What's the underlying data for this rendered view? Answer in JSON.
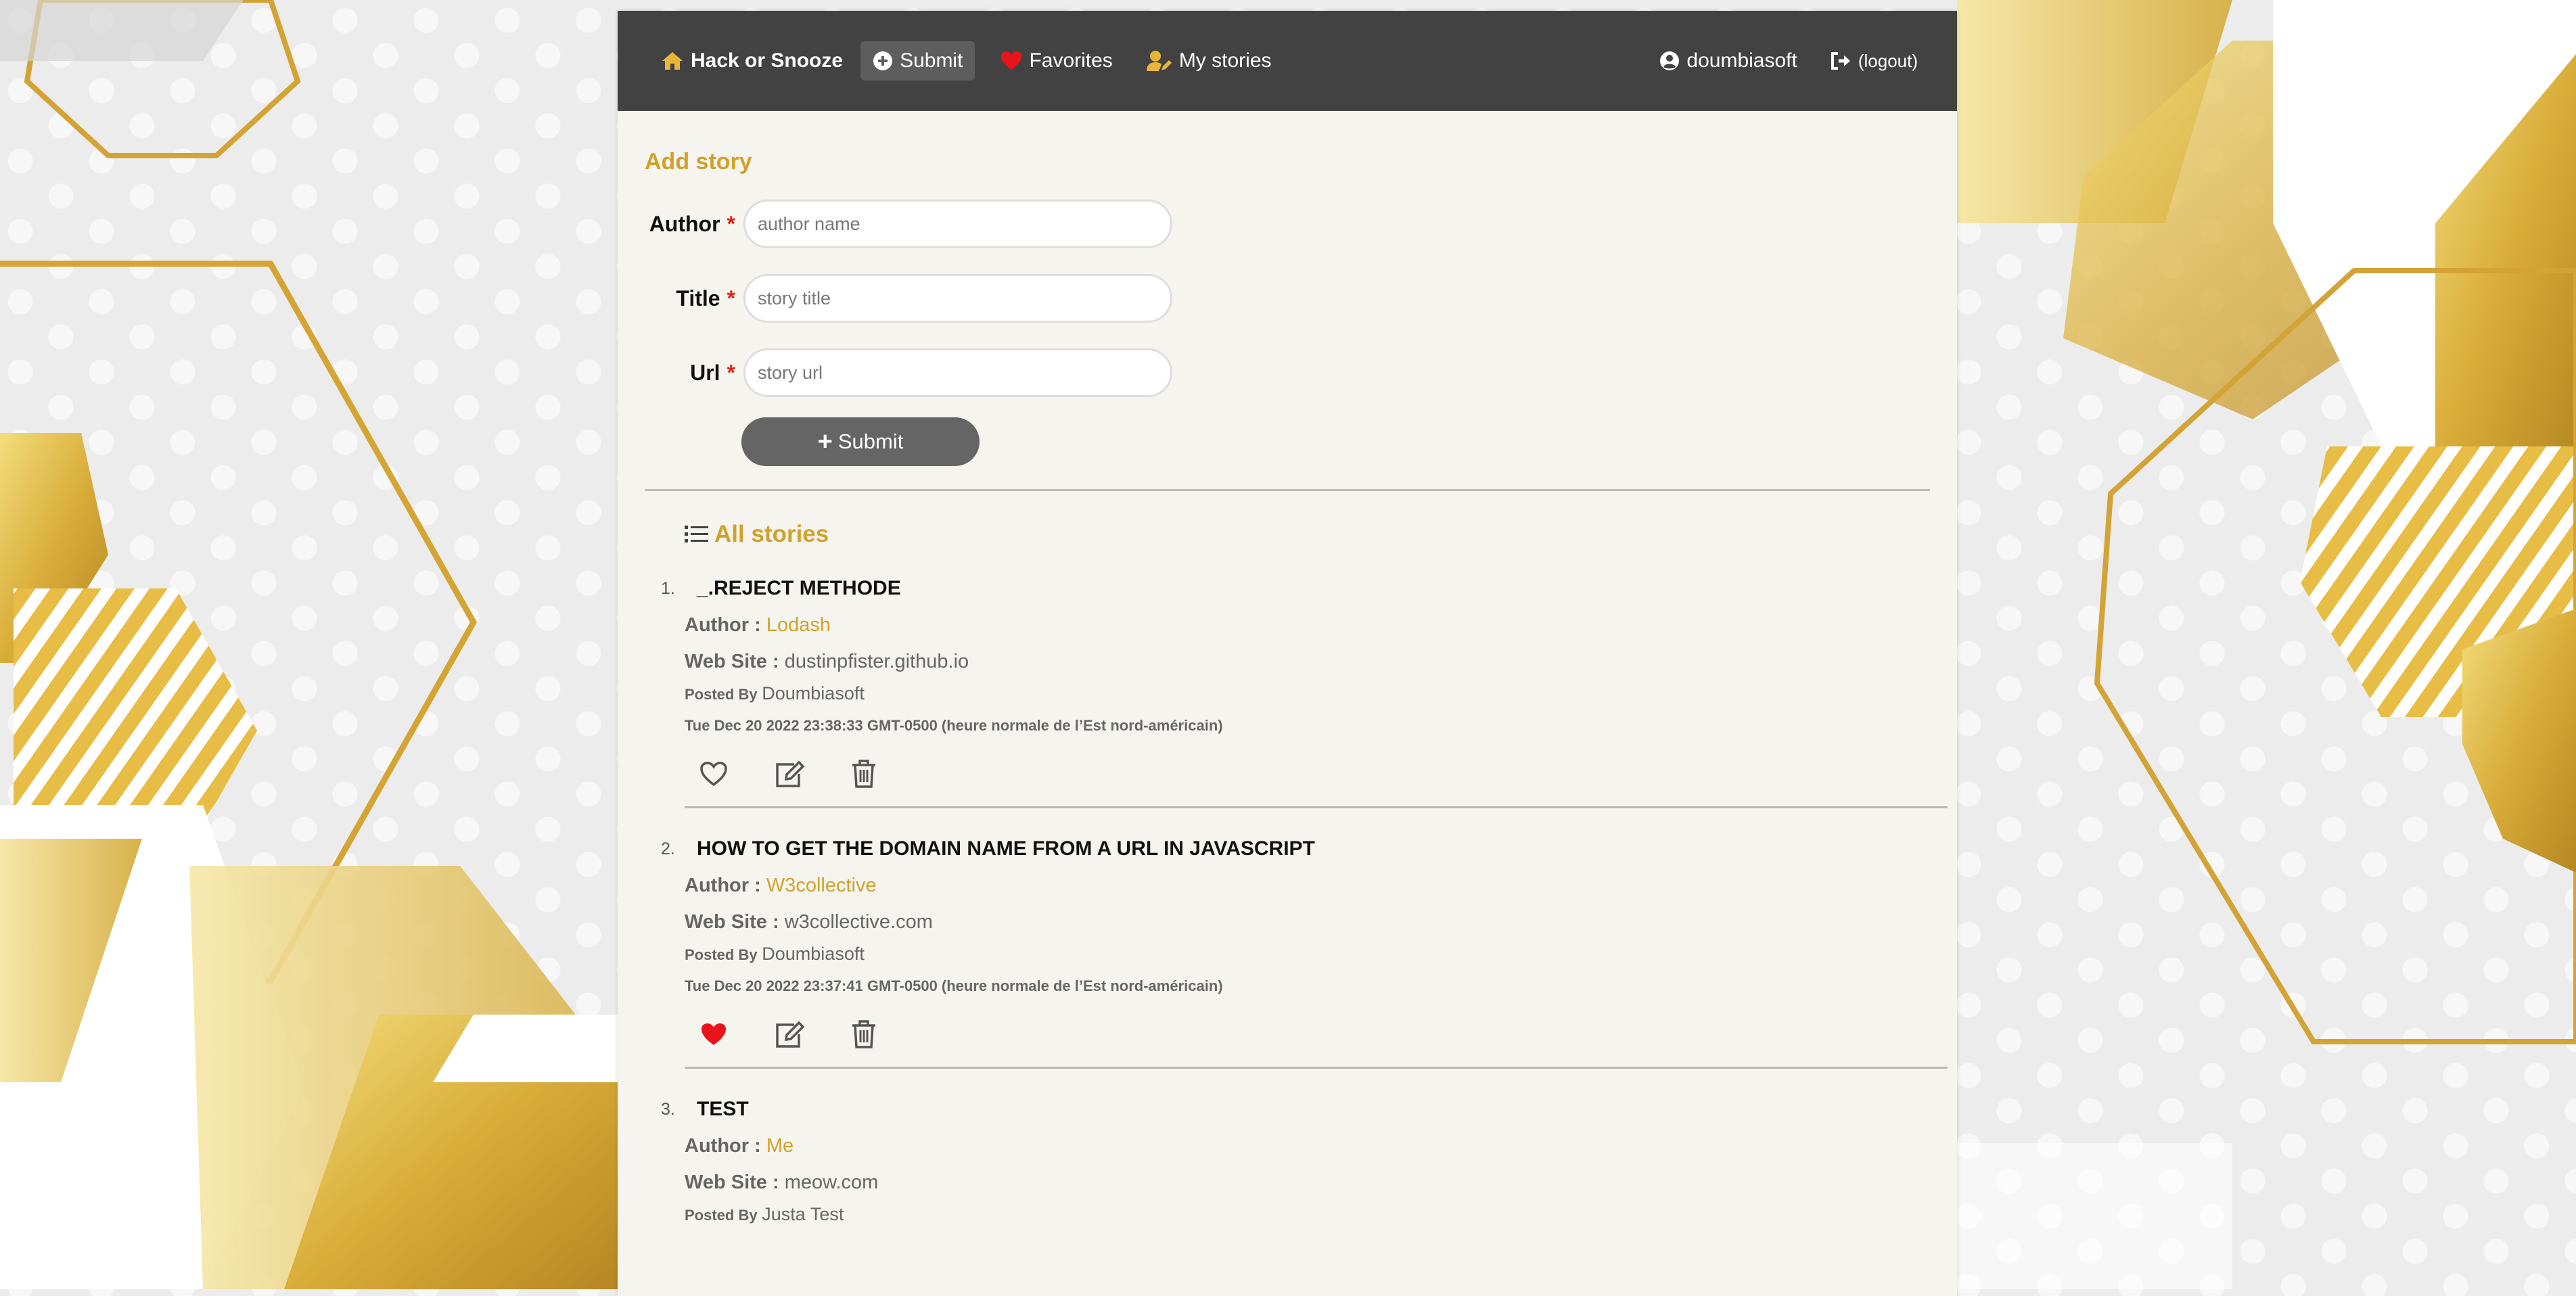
{
  "nav": {
    "brand": "Hack or Snooze",
    "submit": "Submit",
    "favorites": "Favorites",
    "my_stories": "My stories",
    "username": "doumbiasoft",
    "logout": "(logout)"
  },
  "form": {
    "title": "Add story",
    "author_label": "Author",
    "author_placeholder": "author name",
    "title_label": "Title",
    "title_placeholder": "story title",
    "url_label": "Url",
    "url_placeholder": "story url",
    "required_mark": "*",
    "submit_label": "Submit"
  },
  "stories_header": "All stories",
  "labels": {
    "author": "Author :",
    "website": "Web Site :",
    "posted_by": "Posted By"
  },
  "stories": [
    {
      "num": "1.",
      "title": "_.REJECT METHODE",
      "author": "Lodash",
      "website": "dustinpfister.github.io",
      "posted_by": "Doumbiasoft",
      "date": "Tue Dec 20 2022 23:38:33 GMT-0500 (heure normale de l’Est nord-américain)",
      "favorite": false
    },
    {
      "num": "2.",
      "title": "HOW TO GET THE DOMAIN NAME FROM A URL IN JAVASCRIPT",
      "author": "W3collective",
      "website": "w3collective.com",
      "posted_by": "Doumbiasoft",
      "date": "Tue Dec 20 2022 23:37:41 GMT-0500 (heure normale de l’Est nord-américain)",
      "favorite": true
    },
    {
      "num": "3.",
      "title": "TEST",
      "author": "Me",
      "website": "meow.com",
      "posted_by": "Justa Test",
      "date": "",
      "favorite": false
    }
  ],
  "colors": {
    "accent": "#d0a22c",
    "nav_bg": "#424242",
    "favorite": "#e8141b",
    "required": "#e0241b"
  }
}
